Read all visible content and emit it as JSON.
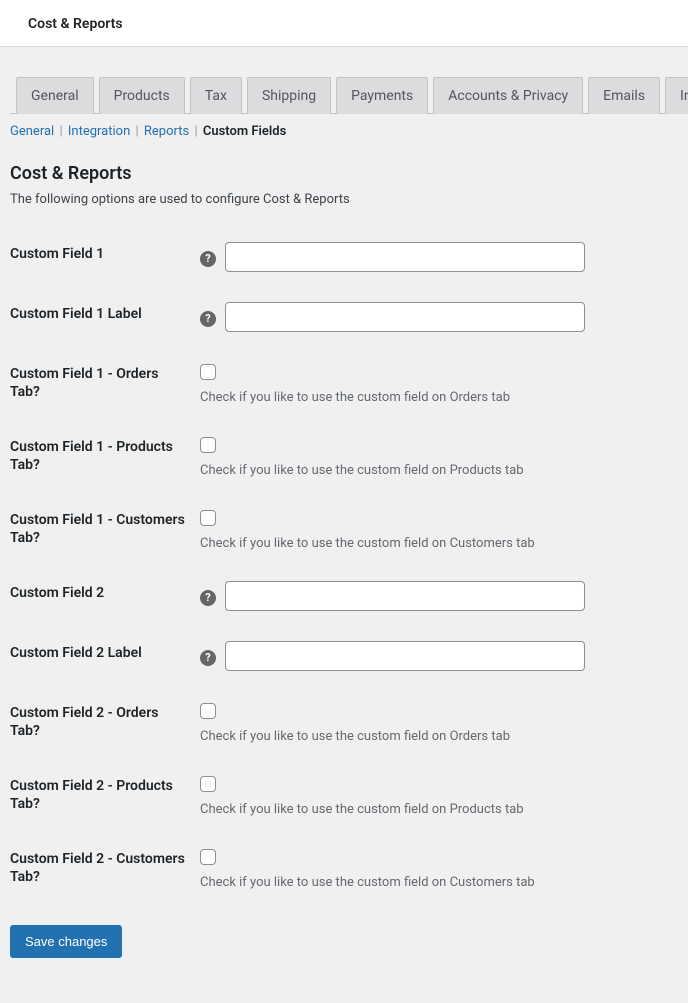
{
  "header": {
    "title": "Cost & Reports"
  },
  "tabs": {
    "general": "General",
    "products": "Products",
    "tax": "Tax",
    "shipping": "Shipping",
    "payments": "Payments",
    "accounts": "Accounts & Privacy",
    "emails": "Emails",
    "integration": "Integration"
  },
  "subsub": {
    "general": "General",
    "integration": "Integration",
    "reports": "Reports",
    "custom_fields": "Custom Fields"
  },
  "section": {
    "title": "Cost & Reports",
    "desc": "The following options are used to configure Cost & Reports"
  },
  "fields": {
    "cf1": {
      "label": "Custom Field 1",
      "value": ""
    },
    "cf1_label": {
      "label": "Custom Field 1 Label",
      "value": ""
    },
    "cf1_orders": {
      "label": "Custom Field 1 - Orders Tab?",
      "desc": "Check if you like to use the custom field on Orders tab"
    },
    "cf1_products": {
      "label": "Custom Field 1 - Products Tab?",
      "desc": "Check if you like to use the custom field on Products tab"
    },
    "cf1_customers": {
      "label": "Custom Field 1 - Customers Tab?",
      "desc": "Check if you like to use the custom field on Customers tab"
    },
    "cf2": {
      "label": "Custom Field 2",
      "value": ""
    },
    "cf2_label": {
      "label": "Custom Field 2 Label",
      "value": ""
    },
    "cf2_orders": {
      "label": "Custom Field 2 - Orders Tab?",
      "desc": "Check if you like to use the custom field on Orders tab"
    },
    "cf2_products": {
      "label": "Custom Field 2 - Products Tab?",
      "desc": "Check if you like to use the custom field on Products tab"
    },
    "cf2_customers": {
      "label": "Custom Field 2 - Customers Tab?",
      "desc": "Check if you like to use the custom field on Customers tab"
    }
  },
  "buttons": {
    "save": "Save changes"
  },
  "help_tip": "?"
}
